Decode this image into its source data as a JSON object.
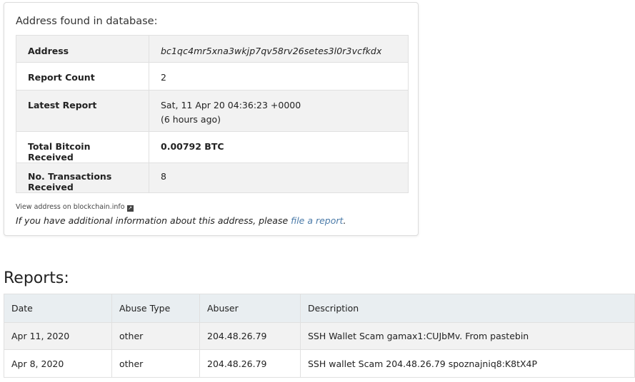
{
  "summary": {
    "title": "Address found in database:",
    "rows": [
      {
        "key": "Address",
        "value": "bc1qc4mr5xna3wkjp7qv58rv26setes3l0r3vcfkdx"
      },
      {
        "key": "Report Count",
        "value": "2"
      },
      {
        "key": "Latest Report",
        "value": "Sat, 11 Apr 20 04:36:23 +0000",
        "value2": "(6 hours ago)"
      },
      {
        "key": "Total Bitcoin Received",
        "value": "0.00792 BTC"
      },
      {
        "key": "No. Transactions Received",
        "value": "8"
      }
    ],
    "view_link": "View address on blockchain.info",
    "external_icon": "external-link-icon",
    "additional_prefix": "If you have additional information about this address, please ",
    "additional_link": "file a report",
    "additional_suffix": "."
  },
  "reports": {
    "heading": "Reports:",
    "columns": [
      "Date",
      "Abuse Type",
      "Abuser",
      "Description"
    ],
    "rows": [
      {
        "date": "Apr 11, 2020",
        "type": "other",
        "abuser": "204.48.26.79",
        "description": "SSH Wallet Scam gamax1:CUJbMv. From pastebin"
      },
      {
        "date": "Apr 8, 2020",
        "type": "other",
        "abuser": "204.48.26.79",
        "description": "SSH wallet Scam 204.48.26.79 spoznajniq8:K8tX4P"
      }
    ]
  },
  "colors": {
    "link": "#4a7aa8",
    "header_bg": "#e9eef1",
    "stripe": "#f2f2f2"
  }
}
